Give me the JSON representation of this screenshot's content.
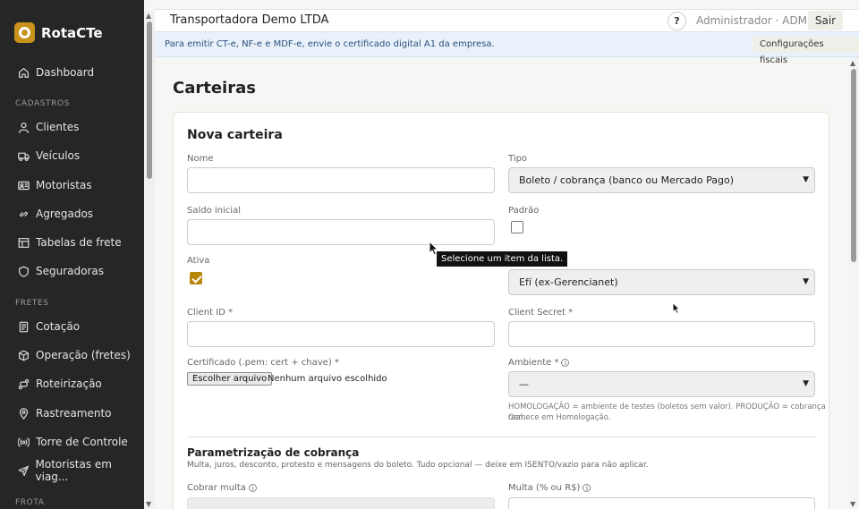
{
  "app": {
    "brand": "RotaCTe",
    "sidebar": {
      "items_top": [
        {
          "label": "Dashboard",
          "icon": "home-icon"
        }
      ],
      "section_cadastros": "CADASTROS",
      "cadastros": [
        {
          "label": "Clientes",
          "icon": "user-icon"
        },
        {
          "label": "Veículos",
          "icon": "truck-icon"
        },
        {
          "label": "Motoristas",
          "icon": "id-card-icon"
        },
        {
          "label": "Agregados",
          "icon": "link-icon"
        },
        {
          "label": "Tabelas de frete",
          "icon": "table-icon"
        },
        {
          "label": "Seguradoras",
          "icon": "shield-icon"
        }
      ],
      "section_fretes": "FRETES",
      "fretes": [
        {
          "label": "Cotação",
          "icon": "document-icon"
        },
        {
          "label": "Operação (fretes)",
          "icon": "box-icon"
        },
        {
          "label": "Roteirização",
          "icon": "route-icon"
        },
        {
          "label": "Rastreamento",
          "icon": "map-pin-icon"
        },
        {
          "label": "Torre de Controle",
          "icon": "broadcast-icon"
        },
        {
          "label": "Motoristas em viag...",
          "icon": "send-icon"
        }
      ],
      "section_frota": "FROTA"
    }
  },
  "topbar": {
    "company": "Transportadora Demo LTDA",
    "help": "?",
    "user": "Administrador · ADMIN",
    "logout": "Sair"
  },
  "banner": {
    "message": "Para emitir CT-e, NF-e e MDF-e, envie o certificado digital A1 da empresa.",
    "button": "Configurações fiscais"
  },
  "page": {
    "title": "Carteiras",
    "form": {
      "title": "Nova carteira",
      "nome_label": "Nome",
      "nome_value": "",
      "tipo_label": "Tipo",
      "tipo_value": "Boleto / cobrança (banco ou Mercado Pago)",
      "saldo_label": "Saldo inicial",
      "saldo_value": "",
      "padrao_label": "Padrão",
      "padrao_checked": false,
      "ativa_label": "Ativa",
      "ativa_checked": true,
      "provedor_value": "Efí (ex-Gerencianet)",
      "client_id_label": "Client ID *",
      "client_secret_label": "Client Secret *",
      "cert_label": "Certificado (.pem: cert + chave) *",
      "file_button": "Escolher arquivo",
      "file_status": "Nenhum arquivo escolhido",
      "ambiente_label": "Ambiente *",
      "ambiente_value": "—",
      "ambiente_hint_line1": "HOMOLOGAÇÃO = ambiente de testes (boletos sem valor). PRODUÇÃO = cobrança real.",
      "ambiente_hint_line2": "Comece em Homologação.",
      "section_title": "Parametrização de cobrança",
      "section_desc": "Multa, juros, desconto, protesto e mensagens do boleto. Tudo opcional — deixe em ISENTO/vazio para não aplicar.",
      "cobrar_multa_label": "Cobrar multa",
      "multa_label": "Multa (% ou R$)"
    },
    "tooltip": "Selecione um item da lista."
  }
}
